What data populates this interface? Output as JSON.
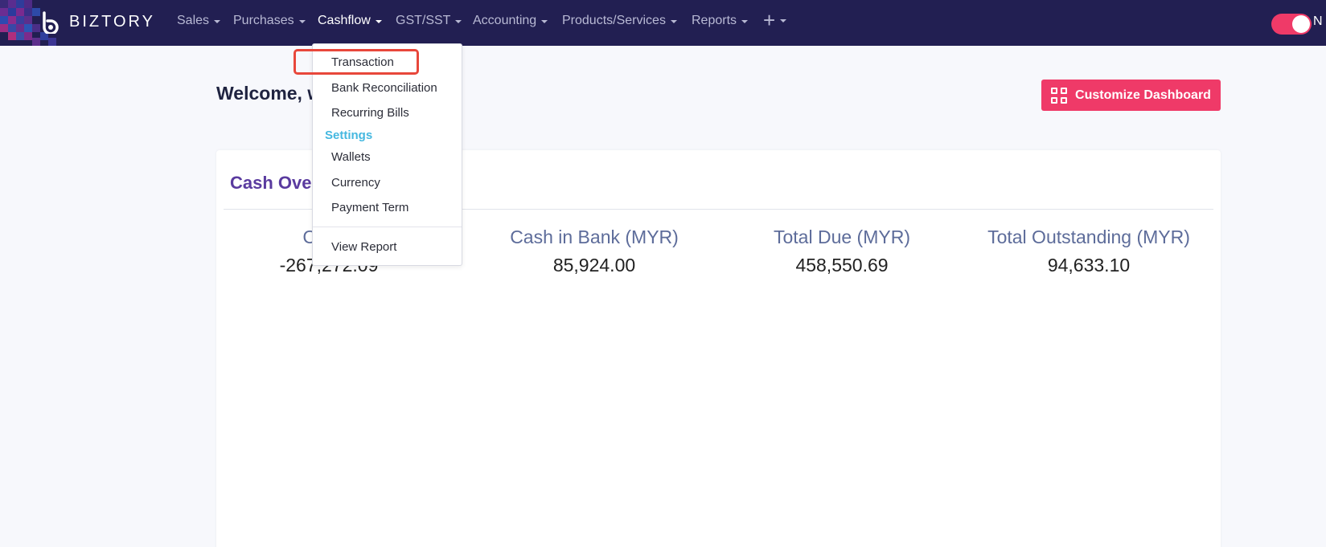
{
  "app": {
    "brand": "BIZTORY"
  },
  "nav": {
    "items": [
      {
        "label": "Sales"
      },
      {
        "label": "Purchases"
      },
      {
        "label": "Cashflow"
      },
      {
        "label": "GST/SST"
      },
      {
        "label": "Accounting"
      },
      {
        "label": "Products/Services"
      },
      {
        "label": "Reports"
      }
    ],
    "active": "Cashflow",
    "right_text": "N"
  },
  "header": {
    "welcome": "Welcome, w",
    "customize_label": "Customize Dashboard"
  },
  "card": {
    "title": "Cash Over",
    "stats": [
      {
        "label": "Cash i",
        "value": "-267,272.09"
      },
      {
        "label": "Cash in Bank (MYR)",
        "value": "85,924.00"
      },
      {
        "label": "Total Due (MYR)",
        "value": "458,550.69"
      },
      {
        "label": "Total Outstanding (MYR)",
        "value": "94,633.10"
      }
    ]
  },
  "dropdown": {
    "items": [
      {
        "label": "Transaction"
      },
      {
        "label": "Bank Reconciliation"
      },
      {
        "label": "Recurring Bills"
      }
    ],
    "settings_header": "Settings",
    "settings_items": [
      {
        "label": "Wallets"
      },
      {
        "label": "Currency"
      },
      {
        "label": "Payment Term"
      }
    ],
    "report_label": "View Report"
  },
  "colors": {
    "navbar": "#221f52",
    "accent": "#ef3a68",
    "highlight": "#e8473b",
    "card_title": "#5a3b9f",
    "settings_header": "#45b8e0"
  }
}
